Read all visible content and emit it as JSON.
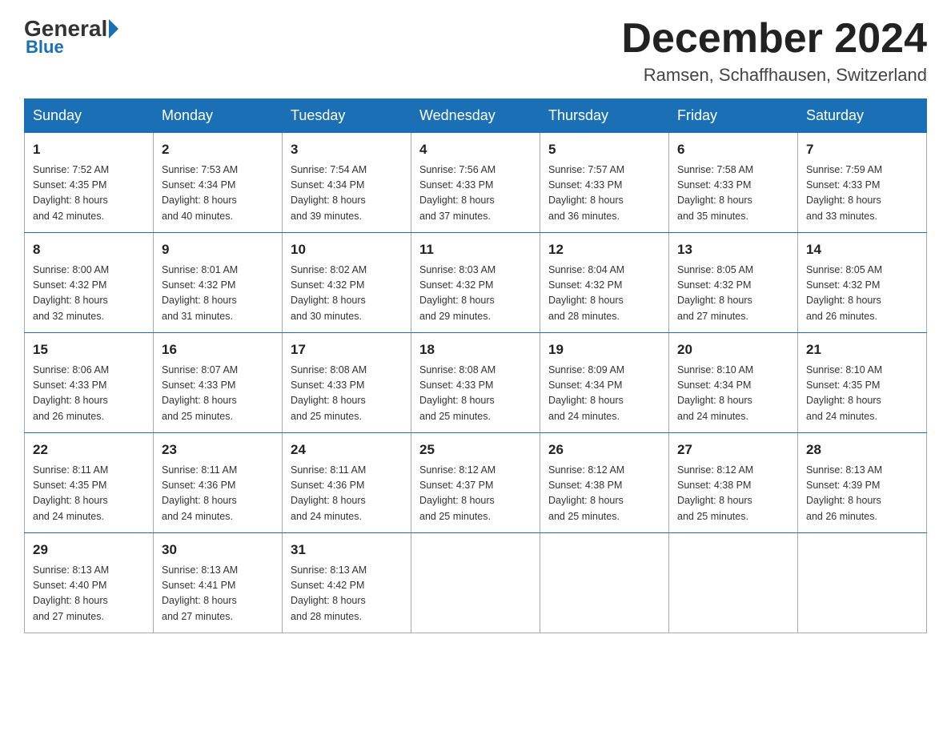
{
  "header": {
    "logo_general": "General",
    "logo_blue": "Blue",
    "month_title": "December 2024",
    "location": "Ramsen, Schaffhausen, Switzerland"
  },
  "days_of_week": [
    "Sunday",
    "Monday",
    "Tuesday",
    "Wednesday",
    "Thursday",
    "Friday",
    "Saturday"
  ],
  "weeks": [
    [
      {
        "day": "1",
        "sunrise": "7:52 AM",
        "sunset": "4:35 PM",
        "daylight": "8 hours and 42 minutes."
      },
      {
        "day": "2",
        "sunrise": "7:53 AM",
        "sunset": "4:34 PM",
        "daylight": "8 hours and 40 minutes."
      },
      {
        "day": "3",
        "sunrise": "7:54 AM",
        "sunset": "4:34 PM",
        "daylight": "8 hours and 39 minutes."
      },
      {
        "day": "4",
        "sunrise": "7:56 AM",
        "sunset": "4:33 PM",
        "daylight": "8 hours and 37 minutes."
      },
      {
        "day": "5",
        "sunrise": "7:57 AM",
        "sunset": "4:33 PM",
        "daylight": "8 hours and 36 minutes."
      },
      {
        "day": "6",
        "sunrise": "7:58 AM",
        "sunset": "4:33 PM",
        "daylight": "8 hours and 35 minutes."
      },
      {
        "day": "7",
        "sunrise": "7:59 AM",
        "sunset": "4:33 PM",
        "daylight": "8 hours and 33 minutes."
      }
    ],
    [
      {
        "day": "8",
        "sunrise": "8:00 AM",
        "sunset": "4:32 PM",
        "daylight": "8 hours and 32 minutes."
      },
      {
        "day": "9",
        "sunrise": "8:01 AM",
        "sunset": "4:32 PM",
        "daylight": "8 hours and 31 minutes."
      },
      {
        "day": "10",
        "sunrise": "8:02 AM",
        "sunset": "4:32 PM",
        "daylight": "8 hours and 30 minutes."
      },
      {
        "day": "11",
        "sunrise": "8:03 AM",
        "sunset": "4:32 PM",
        "daylight": "8 hours and 29 minutes."
      },
      {
        "day": "12",
        "sunrise": "8:04 AM",
        "sunset": "4:32 PM",
        "daylight": "8 hours and 28 minutes."
      },
      {
        "day": "13",
        "sunrise": "8:05 AM",
        "sunset": "4:32 PM",
        "daylight": "8 hours and 27 minutes."
      },
      {
        "day": "14",
        "sunrise": "8:05 AM",
        "sunset": "4:32 PM",
        "daylight": "8 hours and 26 minutes."
      }
    ],
    [
      {
        "day": "15",
        "sunrise": "8:06 AM",
        "sunset": "4:33 PM",
        "daylight": "8 hours and 26 minutes."
      },
      {
        "day": "16",
        "sunrise": "8:07 AM",
        "sunset": "4:33 PM",
        "daylight": "8 hours and 25 minutes."
      },
      {
        "day": "17",
        "sunrise": "8:08 AM",
        "sunset": "4:33 PM",
        "daylight": "8 hours and 25 minutes."
      },
      {
        "day": "18",
        "sunrise": "8:08 AM",
        "sunset": "4:33 PM",
        "daylight": "8 hours and 25 minutes."
      },
      {
        "day": "19",
        "sunrise": "8:09 AM",
        "sunset": "4:34 PM",
        "daylight": "8 hours and 24 minutes."
      },
      {
        "day": "20",
        "sunrise": "8:10 AM",
        "sunset": "4:34 PM",
        "daylight": "8 hours and 24 minutes."
      },
      {
        "day": "21",
        "sunrise": "8:10 AM",
        "sunset": "4:35 PM",
        "daylight": "8 hours and 24 minutes."
      }
    ],
    [
      {
        "day": "22",
        "sunrise": "8:11 AM",
        "sunset": "4:35 PM",
        "daylight": "8 hours and 24 minutes."
      },
      {
        "day": "23",
        "sunrise": "8:11 AM",
        "sunset": "4:36 PM",
        "daylight": "8 hours and 24 minutes."
      },
      {
        "day": "24",
        "sunrise": "8:11 AM",
        "sunset": "4:36 PM",
        "daylight": "8 hours and 24 minutes."
      },
      {
        "day": "25",
        "sunrise": "8:12 AM",
        "sunset": "4:37 PM",
        "daylight": "8 hours and 25 minutes."
      },
      {
        "day": "26",
        "sunrise": "8:12 AM",
        "sunset": "4:38 PM",
        "daylight": "8 hours and 25 minutes."
      },
      {
        "day": "27",
        "sunrise": "8:12 AM",
        "sunset": "4:38 PM",
        "daylight": "8 hours and 25 minutes."
      },
      {
        "day": "28",
        "sunrise": "8:13 AM",
        "sunset": "4:39 PM",
        "daylight": "8 hours and 26 minutes."
      }
    ],
    [
      {
        "day": "29",
        "sunrise": "8:13 AM",
        "sunset": "4:40 PM",
        "daylight": "8 hours and 27 minutes."
      },
      {
        "day": "30",
        "sunrise": "8:13 AM",
        "sunset": "4:41 PM",
        "daylight": "8 hours and 27 minutes."
      },
      {
        "day": "31",
        "sunrise": "8:13 AM",
        "sunset": "4:42 PM",
        "daylight": "8 hours and 28 minutes."
      },
      null,
      null,
      null,
      null
    ]
  ],
  "labels": {
    "sunrise": "Sunrise:",
    "sunset": "Sunset:",
    "daylight": "Daylight:"
  }
}
